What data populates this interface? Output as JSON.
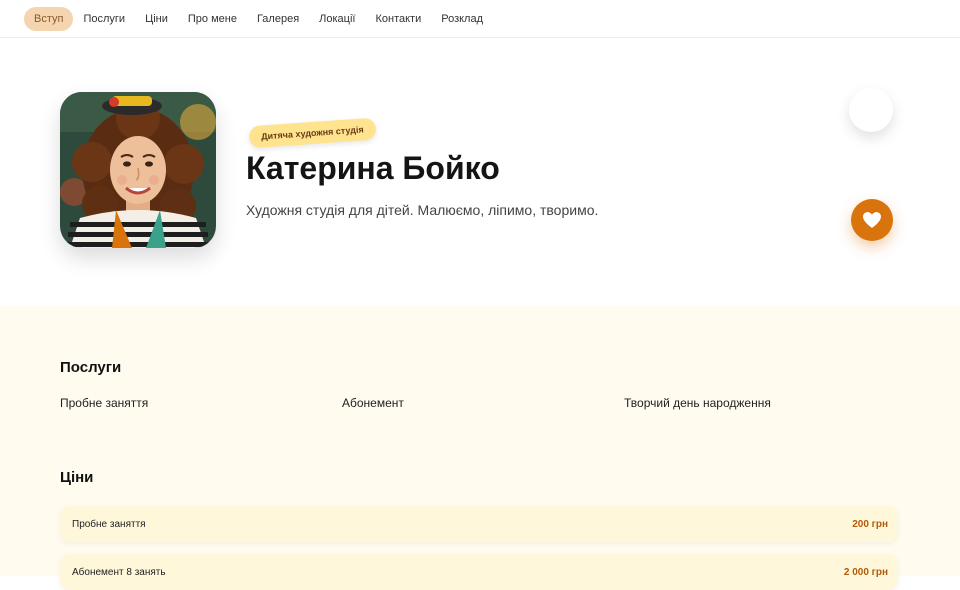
{
  "nav": {
    "items": [
      {
        "label": "Вступ",
        "active": true
      },
      {
        "label": "Послуги",
        "active": false
      },
      {
        "label": "Ціни",
        "active": false
      },
      {
        "label": "Про мене",
        "active": false
      },
      {
        "label": "Галерея",
        "active": false
      },
      {
        "label": "Локації",
        "active": false
      },
      {
        "label": "Контакти",
        "active": false
      },
      {
        "label": "Розклад",
        "active": false
      }
    ]
  },
  "hero": {
    "badge": "Дитяча художня студія",
    "title": "Катерина Бойко",
    "subtitle": "Художня студія для дітей. Малюємо, ліпимо, творимо."
  },
  "icons": {
    "favorite": "heart-icon"
  },
  "services": {
    "title": "Послуги",
    "items": [
      "Пробне заняття",
      "Абонемент",
      "Творчий день народження"
    ]
  },
  "prices": {
    "title": "Ціни",
    "rows": [
      {
        "name": "Пробне заняття",
        "price": "200 грн"
      },
      {
        "name": "Абонемент 8 занять",
        "price": "2 000 грн"
      }
    ]
  },
  "colors": {
    "accent": "#d9730b",
    "nav_active_bg": "#f5d4b0",
    "badge_bg": "#ffe38f",
    "section_bg": "#fffbef",
    "price_row_bg": "#fff7da",
    "price_text": "#b35a08"
  }
}
